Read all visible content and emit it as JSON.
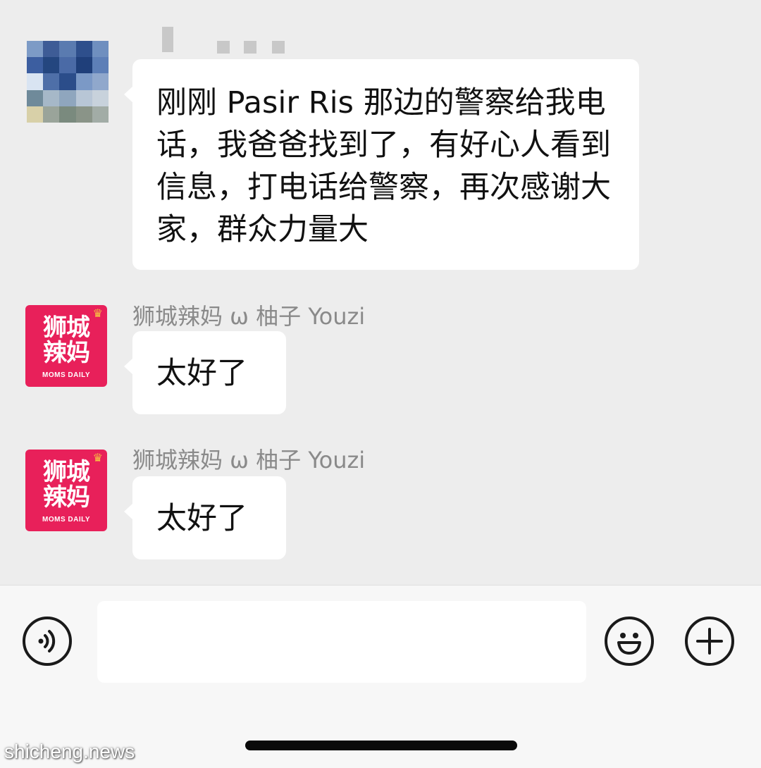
{
  "messages": [
    {
      "sender": "",
      "text": "刚刚 Pasir Ris 那边的警察给我电话，我爸爸找到了，有好心人看到信息，打电话给警察，再次感谢大家，群众力量大"
    },
    {
      "sender": "狮城辣妈 ω 柚子 Youzi",
      "text": "太好了"
    },
    {
      "sender": "狮城辣妈 ω 柚子 Youzi",
      "text": "太好了"
    }
  ],
  "brand_avatar": {
    "line1": "狮城",
    "line2": "辣妈",
    "sub": "MOMS DAILY",
    "color": "#e8205a"
  },
  "input_bar": {
    "value": ""
  },
  "icons": {
    "voice": "voice-icon",
    "emoji": "emoji-icon",
    "add": "plus-icon"
  },
  "watermark": "shicheng.news",
  "colors": {
    "background": "#ededed",
    "bubble": "#ffffff",
    "brand": "#e8205a"
  }
}
